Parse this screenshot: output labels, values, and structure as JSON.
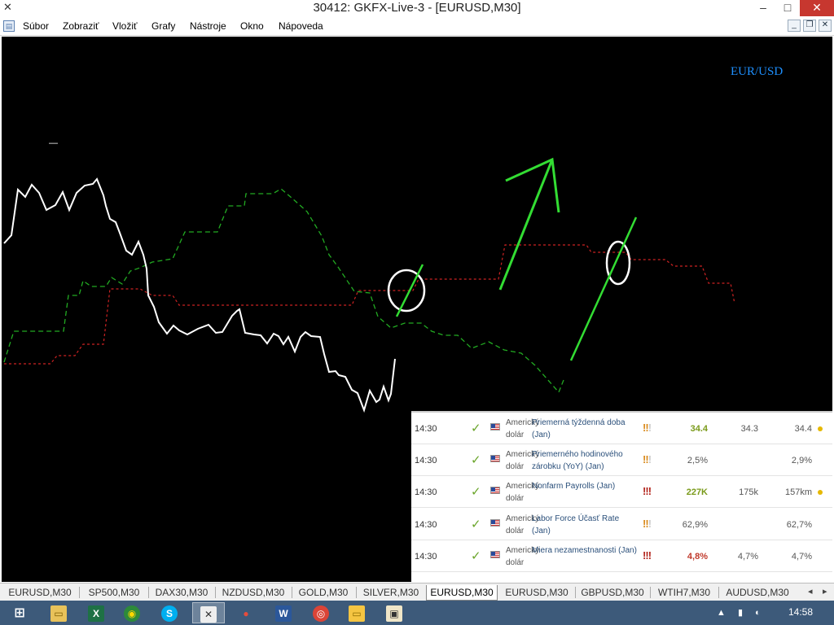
{
  "window": {
    "title": "30412: GKFX-Live-3 - [EURUSD,M30]",
    "minimize_glyph": "–",
    "maximize_glyph": "□",
    "close_glyph": "✕",
    "app_icon": "x-logo-icon"
  },
  "menu": {
    "items": [
      "Súbor",
      "Zobraziť",
      "Vložiť",
      "Grafy",
      "Nástroje",
      "Okno",
      "Nápoveda"
    ],
    "mdi_minimize": "_",
    "mdi_restore": "❐",
    "mdi_close": "✕"
  },
  "chart": {
    "symbol": "EUR/USD",
    "tiny_mark": "—",
    "background": "#000000",
    "price_line_color": "#ffffff",
    "green_line_color": "#22aa22",
    "red_line_color": "#cc2222",
    "annotation_color": "#33dd33"
  },
  "calendar": {
    "rows": [
      {
        "time": "14:30",
        "country": "Americký dolár",
        "event": "Priemerná týždenná doba (Jan)",
        "importance": "!!!",
        "imp_level": 2,
        "actual": "34.4",
        "actual_color": "#7a9a1a",
        "forecast": "34.3",
        "previous": "34.4",
        "dot": true
      },
      {
        "time": "14:30",
        "country": "Americký dolár",
        "event": "Priemerného hodinového zárobku (YoY) (Jan)",
        "importance": "!!!",
        "imp_level": 2,
        "actual": "2,5%",
        "actual_color": "#555555",
        "forecast": "",
        "previous": "2,9%",
        "dot": false
      },
      {
        "time": "14:30",
        "country": "Americký dolár",
        "event": "Nonfarm Payrolls (Jan)",
        "importance": "!!!",
        "imp_level": 3,
        "actual": "227K",
        "actual_color": "#7a9a1a",
        "forecast": "175k",
        "previous": "157km",
        "dot": true
      },
      {
        "time": "14:30",
        "country": "Americký dolár",
        "event": "Labor Force Účasť Rate (Jan)",
        "importance": "!!!",
        "imp_level": 2,
        "actual": "62,9%",
        "actual_color": "#555555",
        "forecast": "",
        "previous": "62,7%",
        "dot": false
      },
      {
        "time": "14:30",
        "country": "Americký dolár",
        "event": "Miera nezamestnanosti (Jan)",
        "importance": "!!!",
        "imp_level": 3,
        "actual": "4,8%",
        "actual_color": "#c0392b",
        "forecast": "4,7%",
        "previous": "4,7%",
        "dot": false
      }
    ]
  },
  "tabs": {
    "items": [
      "EURUSD,M30",
      "SP500,M30",
      "DAX30,M30",
      "NZDUSD,M30",
      "GOLD,M30",
      "SILVER,M30",
      "EURUSD,M30",
      "EURUSD,M30",
      "GBPUSD,M30",
      "WTIH7,M30",
      "AUDUSD,M30"
    ],
    "active_index": 6,
    "prev_arrow": "◂",
    "next_arrow": "▸"
  },
  "taskbar": {
    "start_icon": "windows-start-icon",
    "clock": "14:58",
    "tray": "▲ ▮ ◐"
  }
}
